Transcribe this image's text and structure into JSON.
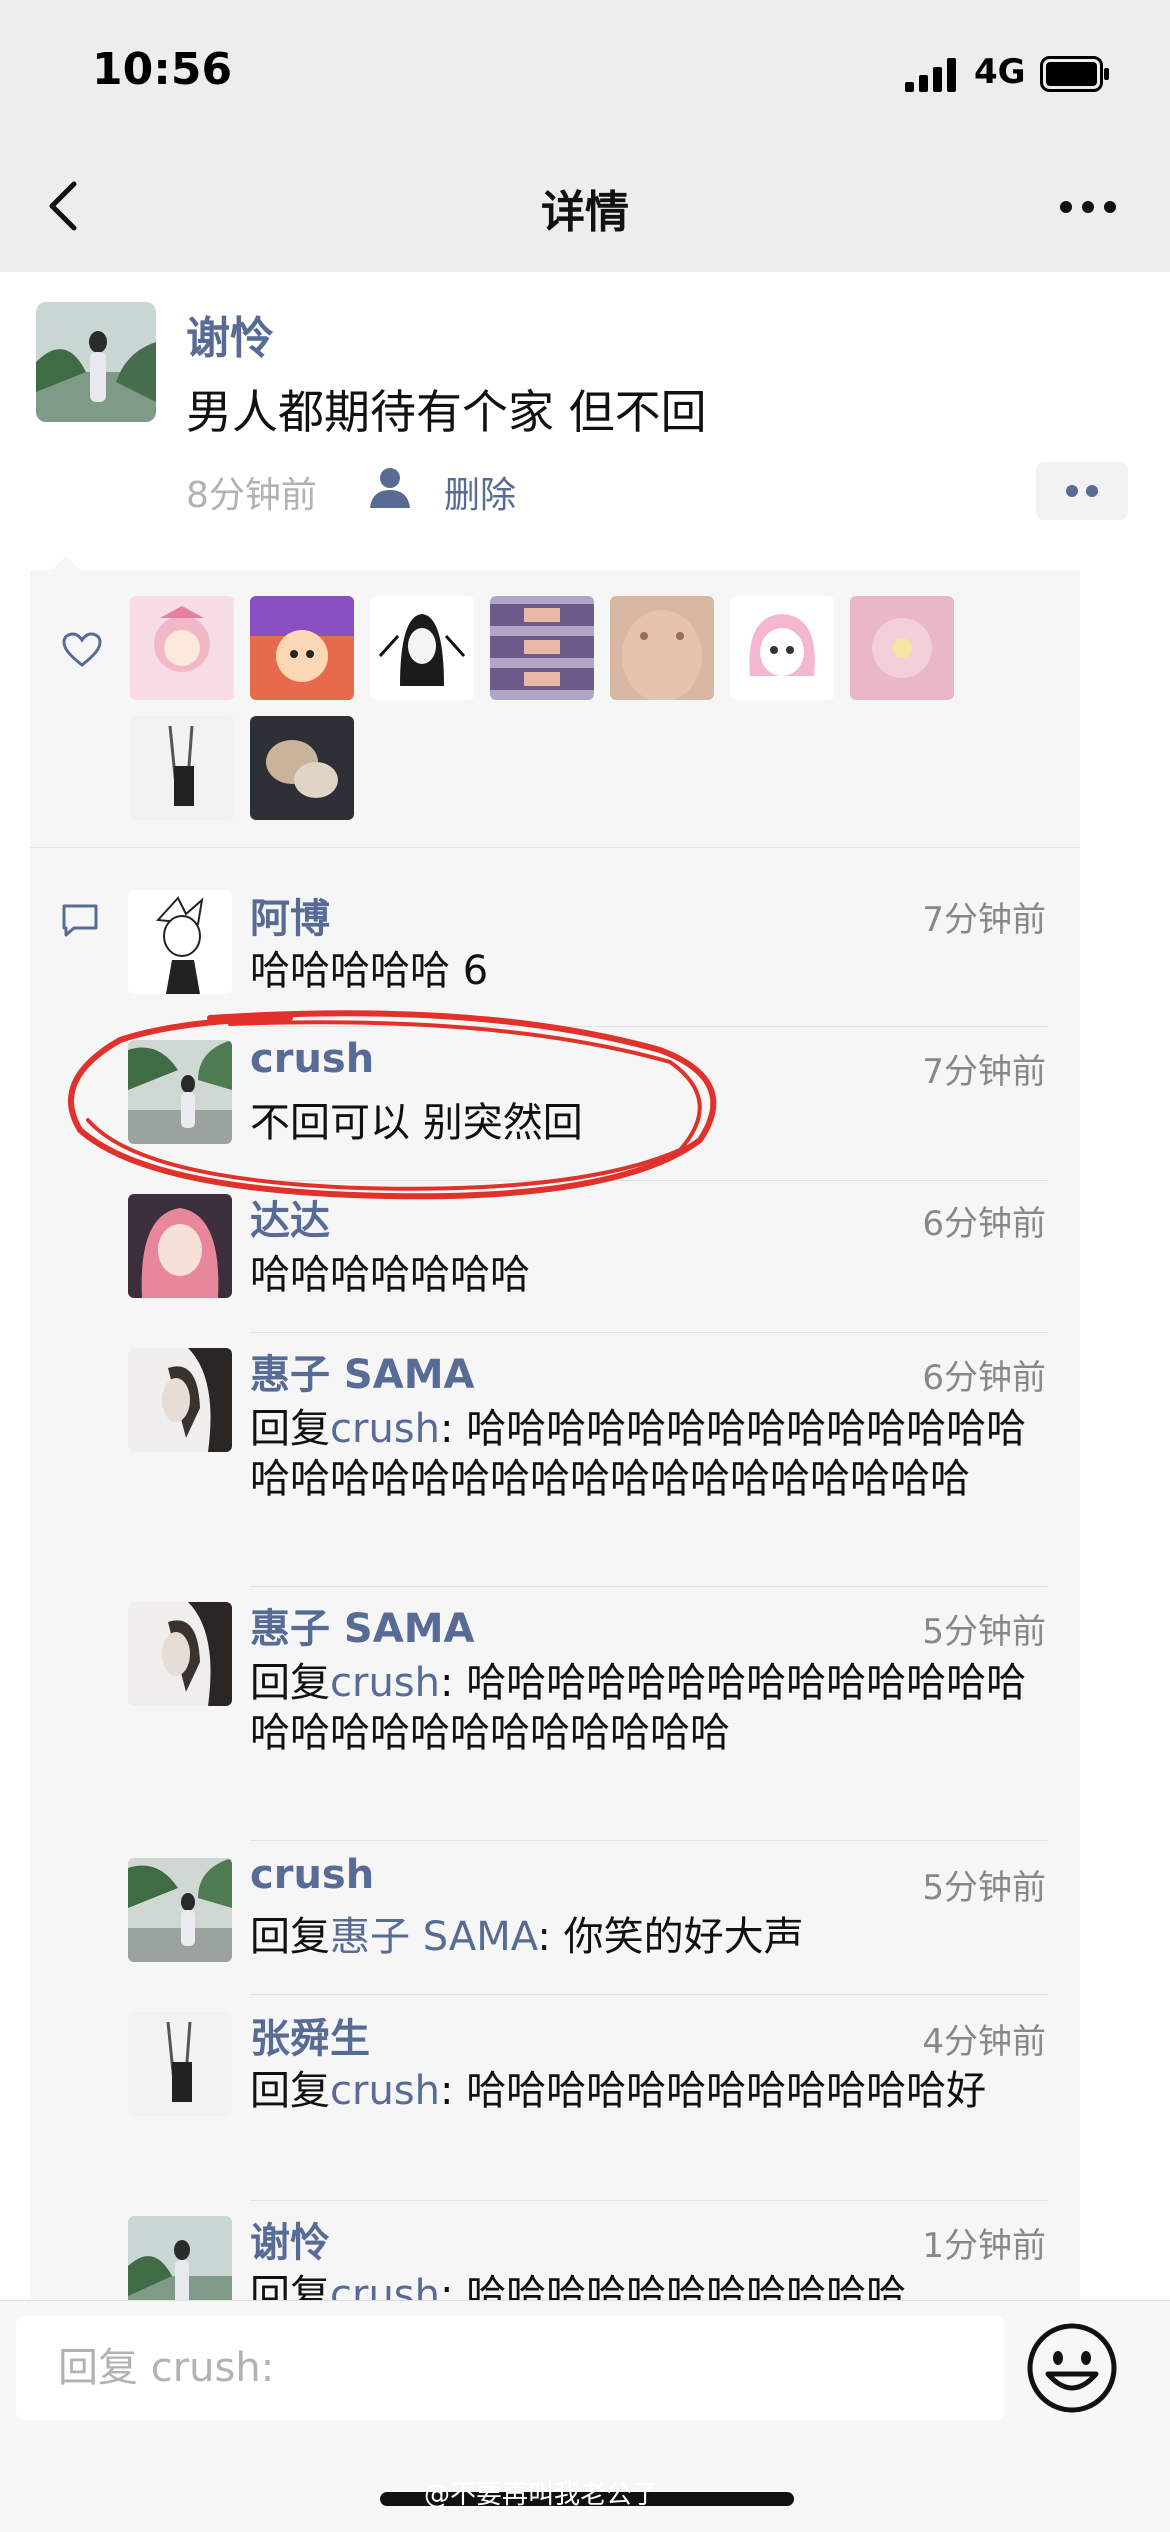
{
  "status_bar": {
    "time": "10:56",
    "network": "4G"
  },
  "nav": {
    "title": "详情"
  },
  "post": {
    "author": "谢怜",
    "text": "男人都期待有个家 但不回",
    "time": "8分钟前",
    "delete_label": "删除"
  },
  "likes": {
    "count": 9
  },
  "comments": [
    {
      "name": "阿博",
      "time": "7分钟前",
      "reply_prefix": "",
      "reply_to": "",
      "sep": "",
      "text": "哈哈哈哈哈 6"
    },
    {
      "name": "crush",
      "time": "7分钟前",
      "reply_prefix": "",
      "reply_to": "",
      "sep": "",
      "text": "不回可以 别突然回"
    },
    {
      "name": "达达",
      "time": "6分钟前",
      "reply_prefix": "",
      "reply_to": "",
      "sep": "",
      "text": "哈哈哈哈哈哈哈"
    },
    {
      "name": "惠子 SAMA",
      "time": "6分钟前",
      "reply_prefix": "回复",
      "reply_to": "crush",
      "sep": ": ",
      "text": "哈哈哈哈哈哈哈哈哈哈哈哈哈哈哈哈哈哈哈哈哈哈哈哈哈哈哈哈哈哈哈哈"
    },
    {
      "name": "惠子 SAMA",
      "time": "5分钟前",
      "reply_prefix": "回复",
      "reply_to": "crush",
      "sep": ": ",
      "text": "哈哈哈哈哈哈哈哈哈哈哈哈哈哈哈哈哈哈哈哈哈哈哈哈哈哈"
    },
    {
      "name": "crush",
      "time": "5分钟前",
      "reply_prefix": "回复",
      "reply_to": "惠子 SAMA",
      "sep": ": ",
      "text": "你笑的好大声"
    },
    {
      "name": "张舜生",
      "time": "4分钟前",
      "reply_prefix": "回复",
      "reply_to": "crush",
      "sep": ": ",
      "text": "哈哈哈哈哈哈哈哈哈哈哈哈好"
    },
    {
      "name": "谢怜",
      "time": "1分钟前",
      "reply_prefix": "回复",
      "reply_to": "crush",
      "sep": ": ",
      "text": "哈哈哈哈哈哈哈哈哈哈哈"
    }
  ],
  "input": {
    "placeholder": "回复 crush:"
  },
  "watermark": "@不要再叫我老公了",
  "colors": {
    "name": "#576b95",
    "highlight": "#e0312b",
    "header_bg": "#ededed",
    "panel_bg": "#f6f6f6"
  }
}
